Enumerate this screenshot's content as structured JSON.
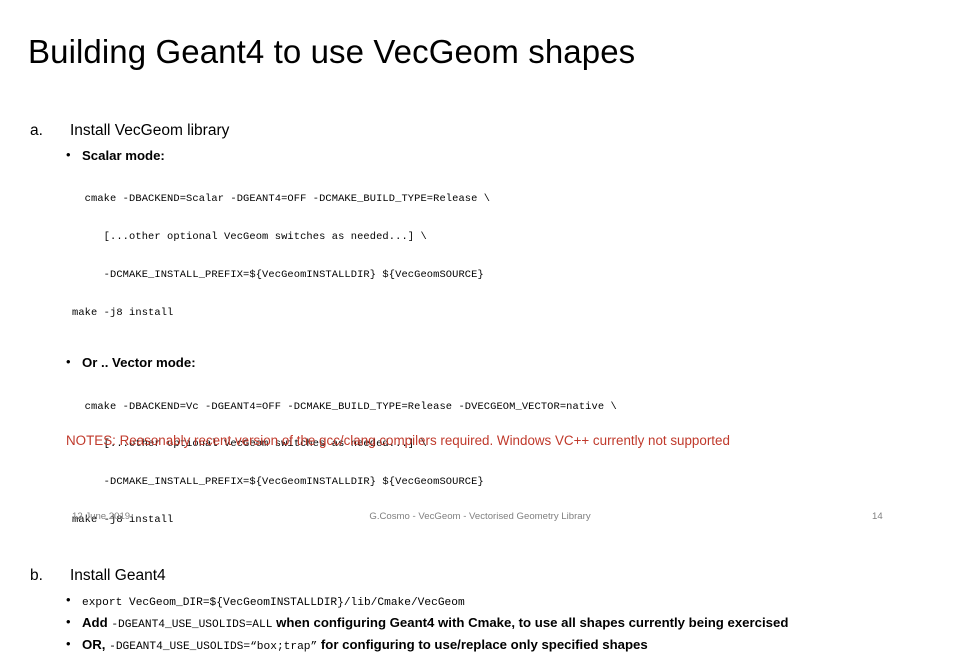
{
  "slide": {
    "title": "Building Geant4 to use VecGeom shapes",
    "page_number": "14"
  },
  "section_a": {
    "marker": "a.",
    "heading": "Install VecGeom library",
    "scalar": {
      "bullet": "•",
      "label": "Scalar mode:",
      "code_lines": [
        "  cmake -DBACKEND=Scalar -DGEANT4=OFF -DCMAKE_BUILD_TYPE=Release \\",
        "     [...other optional VecGeom switches as needed...] \\",
        "     -DCMAKE_INSTALL_PREFIX=${VecGeomINSTALLDIR} ${VecGeomSOURCE}",
        "make -j8 install"
      ]
    },
    "vector": {
      "bullet": "•",
      "label": "Or .. Vector mode:",
      "code_lines": [
        "  cmake -DBACKEND=Vc -DGEANT4=OFF -DCMAKE_BUILD_TYPE=Release -DVECGEOM_VECTOR=native \\",
        "     [...other optional VecGeom switches as needed...] \\",
        "     -DCMAKE_INSTALL_PREFIX=${VecGeomINSTALLDIR} ${VecGeomSOURCE}",
        "make -j8 install"
      ]
    }
  },
  "section_b": {
    "marker": "b.",
    "heading": "Install Geant4",
    "bullets": [
      {
        "bullet": "•",
        "mono_1": "export VecGeom_DIR=${VecGeomINSTALLDIR}/lib/Cmake/VecGeom",
        "text_1": "",
        "mono_2": "",
        "text_2": ""
      },
      {
        "bullet": "•",
        "text_pre": "Add ",
        "mono_1": "-DGEANT4_USE_USOLIDS=ALL",
        "text_post": " when configuring Geant4 with Cmake, to use all shapes currently being exercised"
      },
      {
        "bullet": "•",
        "text_pre": "OR, ",
        "mono_1": "-DGEANT4_USE_USOLIDS=“box;trap”",
        "text_post": " for configuring to use/replace only specified shapes"
      }
    ]
  },
  "notes": {
    "text": "NOTES: Reasonably recent version of the gcc/clang compilers required. Windows VC++ currently not supported",
    "color": "#C0392B"
  },
  "footer": {
    "date": "12 June 2019",
    "center": "G.Cosmo - VecGeom - Vectorised Geometry Library",
    "page": "14"
  }
}
